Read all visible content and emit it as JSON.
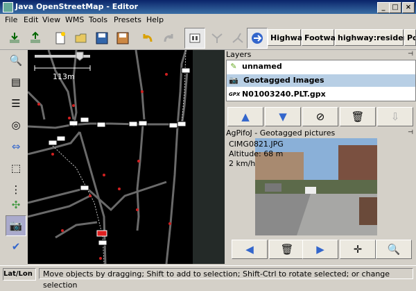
{
  "window": {
    "title": "Java OpenStreetMap - Editor"
  },
  "menu": [
    "File",
    "Edit",
    "View",
    "WMS",
    "Tools",
    "Presets",
    "Help"
  ],
  "toolbar": {
    "icons": [
      "download-icon",
      "upload-icon",
      "new-file-icon",
      "open-file-icon",
      "save-icon",
      "save-as-icon",
      "undo-icon",
      "redo-icon",
      "preferences-icon",
      "merge-nodes-icon",
      "split-way-icon",
      "combine-icon"
    ],
    "presets": [
      "Highway",
      "Footway",
      "highway:residential",
      "Po"
    ]
  },
  "left_tools": [
    "zoom-icon",
    "layer-list-icon",
    "properties-icon",
    "conflict-icon",
    "move-icon",
    "select-icon",
    "add-node-icon",
    "camera-icon",
    "validate-icon"
  ],
  "map": {
    "scale_label": "113m",
    "zoom_slider": 0.8
  },
  "layers_panel": {
    "title": "Layers",
    "items": [
      {
        "label": "unnamed",
        "icon": "osm-data-icon"
      },
      {
        "label": "Geotagged Images",
        "icon": "camera-icon",
        "selected": true
      },
      {
        "label": "N01003240.PLT.gpx",
        "icon": "gpx-icon"
      }
    ],
    "buttons": [
      "move-up-icon",
      "move-down-icon",
      "toggle-visible-icon",
      "delete-icon",
      "merge-icon"
    ]
  },
  "photo_panel": {
    "title": "AgPifoJ - Geotagged pictures",
    "filename": "CIMG0821.JPG",
    "altitude": "Altitude: 68 m",
    "speed": "2 km/h",
    "buttons": [
      "previous-icon",
      "delete-icon",
      "next-icon",
      "center-icon",
      "zoom-icon"
    ]
  },
  "statusbar": {
    "latlon": "Lat/Lon",
    "message": "Move objects by dragging; Shift to add to selection; Shift-Ctrl to rotate selected; or change selection"
  },
  "colors": {
    "title_bar": "#0a246a",
    "selection": "#b8cfe5",
    "map_bg": "#000000",
    "way": "#808080",
    "node": "#e02020"
  }
}
